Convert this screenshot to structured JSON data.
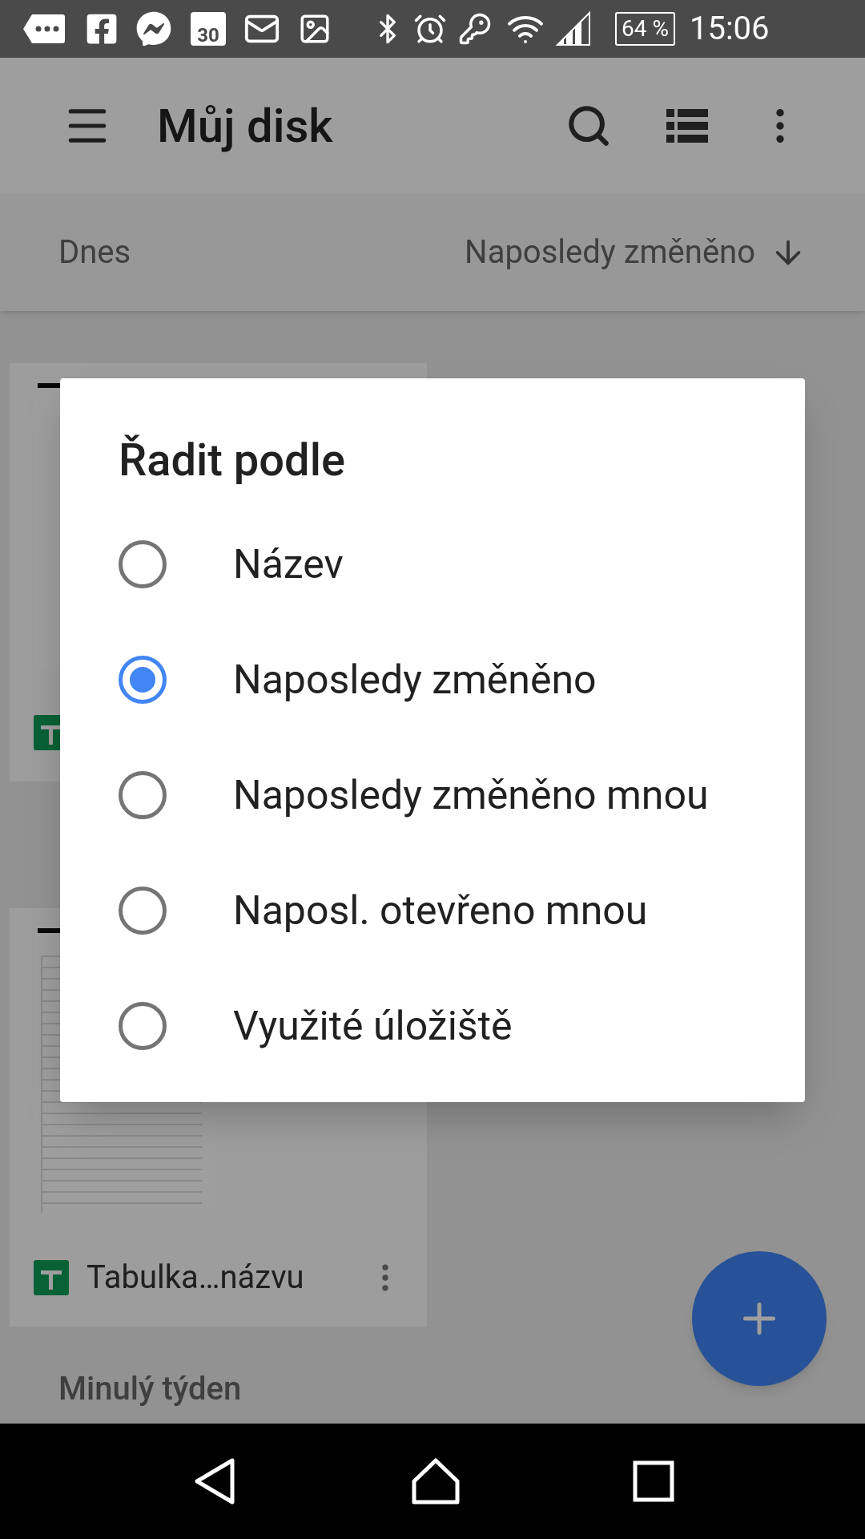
{
  "status_bar": {
    "calendar_day": "30",
    "battery": "64 %",
    "time": "15:06"
  },
  "app_bar": {
    "title": "Můj disk"
  },
  "sort_bar": {
    "section": "Dnes",
    "sort_label": "Naposledy změněno"
  },
  "files": [
    {
      "kind": "spreadsheet"
    },
    {
      "kind": "spreadsheet",
      "name": "Tabulka…názvu"
    }
  ],
  "next_section": "Minulý týden",
  "dialog": {
    "title": "Řadit podle",
    "options": [
      {
        "label": "Název",
        "selected": false
      },
      {
        "label": "Naposledy změněno",
        "selected": true
      },
      {
        "label": "Naposledy změněno mnou",
        "selected": false
      },
      {
        "label": "Naposl. otevřeno mnou",
        "selected": false
      },
      {
        "label": "Využité úložiště",
        "selected": false
      }
    ]
  }
}
